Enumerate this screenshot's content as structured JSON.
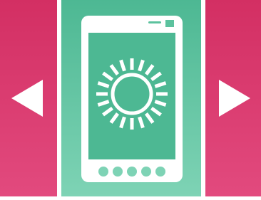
{
  "carousel": {
    "left_button": {
      "icon": "triangle-left-icon",
      "action": "previous"
    },
    "right_button": {
      "icon": "triangle-right-icon",
      "action": "next"
    },
    "slide": {
      "icon": "phone-brightness-icon",
      "sun_icon": "sun-icon",
      "page_dots_total": 5
    }
  },
  "colors": {
    "side_panel_top": "#d32f63",
    "side_panel_bottom": "#e24a7e",
    "center_panel_top": "#4db893",
    "center_panel_bottom": "#7ed3b5",
    "glyph": "#ffffff",
    "background": "#ffffff"
  }
}
